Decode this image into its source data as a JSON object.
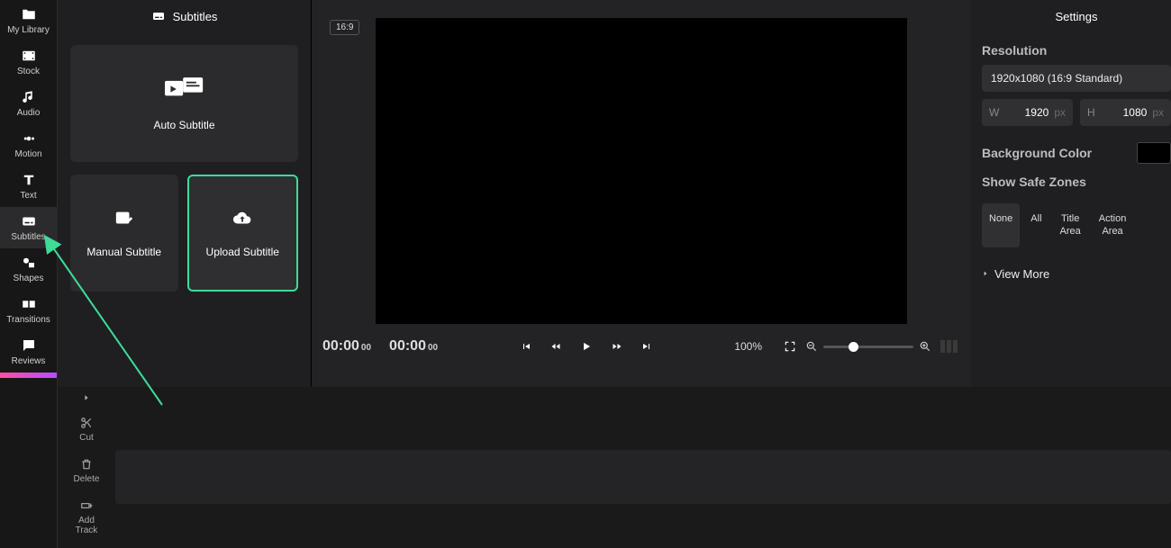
{
  "rail": {
    "items": [
      {
        "label": "My Library"
      },
      {
        "label": "Stock"
      },
      {
        "label": "Audio"
      },
      {
        "label": "Motion"
      },
      {
        "label": "Text"
      },
      {
        "label": "Subtitles"
      },
      {
        "label": "Shapes"
      },
      {
        "label": "Transitions"
      },
      {
        "label": "Reviews"
      }
    ]
  },
  "panel": {
    "title": "Subtitles",
    "auto": "Auto Subtitle",
    "manual": "Manual Subtitle",
    "upload": "Upload Subtitle"
  },
  "preview": {
    "ratio": "16:9",
    "time_current": "00:00",
    "time_current_frames": "00",
    "time_total": "00:00",
    "time_total_frames": "00",
    "zoom_label": "100%"
  },
  "settings": {
    "title": "Settings",
    "resolution_label": "Resolution",
    "resolution_value": "1920x1080 (16:9 Standard)",
    "w_label": "W",
    "w_value": "1920",
    "h_label": "H",
    "h_value": "1080",
    "px": "px",
    "bg_label": "Background Color",
    "safe_label": "Show Safe Zones",
    "zones": [
      "None",
      "All",
      "Title Area",
      "Action Area"
    ],
    "view_more": "View More"
  },
  "tools": {
    "cut": "Cut",
    "delete": "Delete",
    "add_track": "Add Track"
  }
}
